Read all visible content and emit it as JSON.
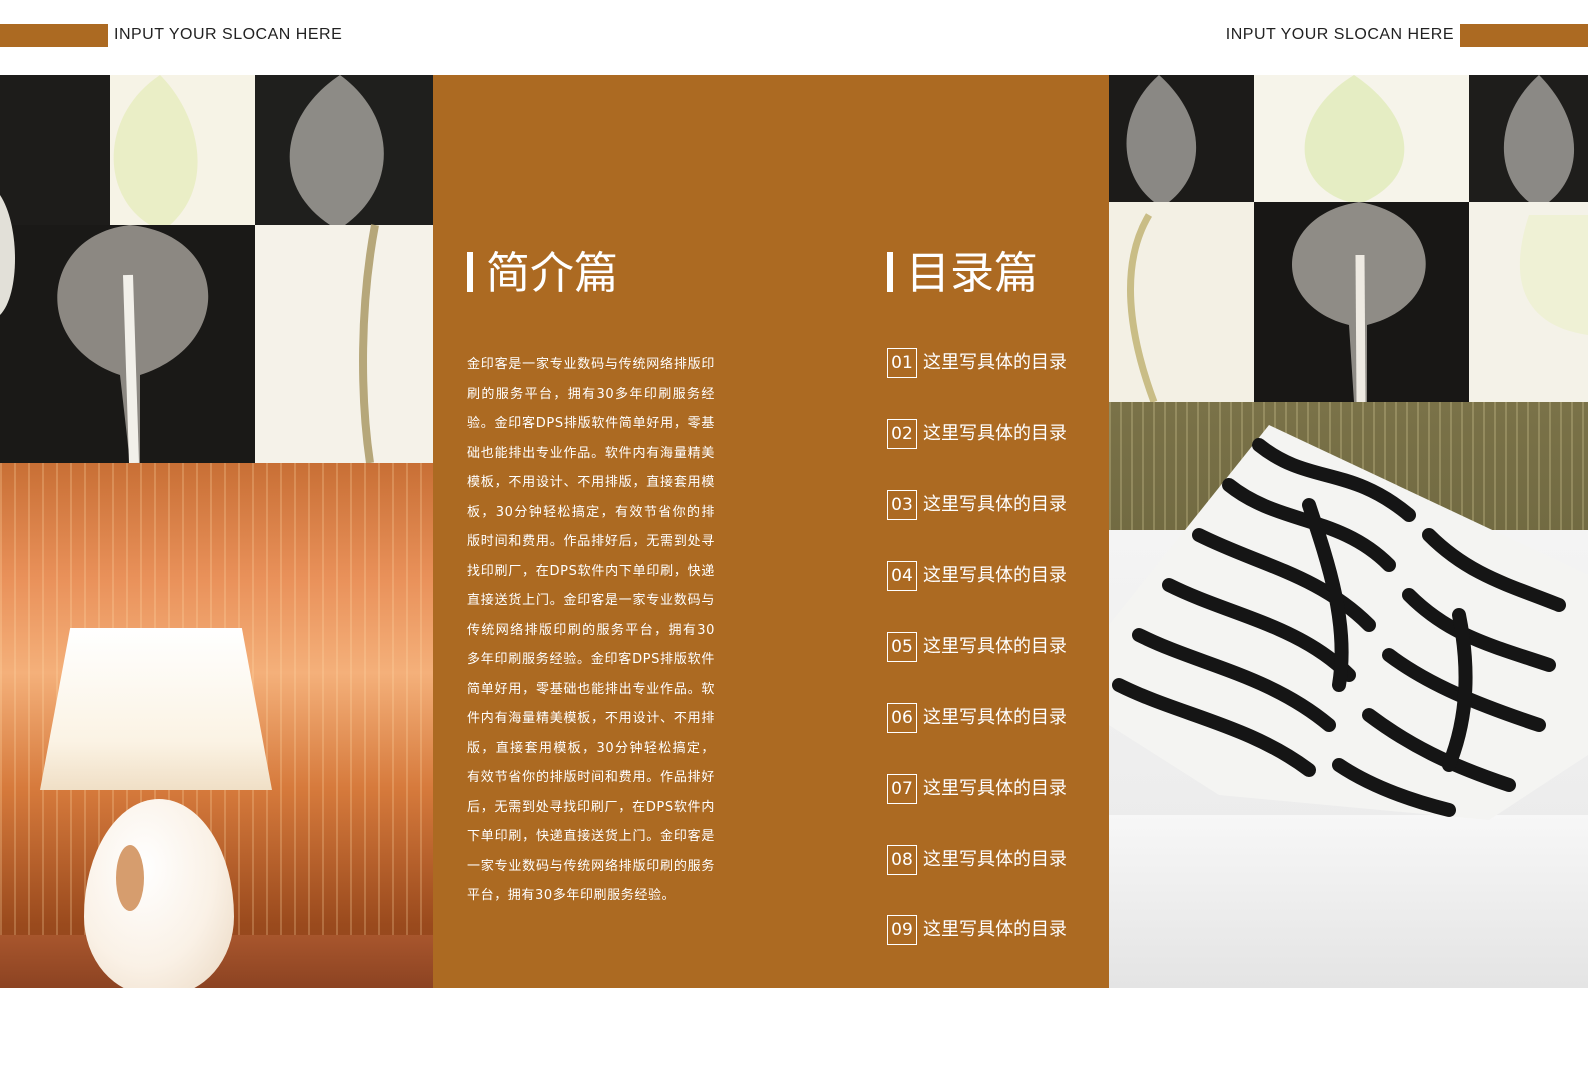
{
  "header": {
    "slogan_left": "INPUT YOUR SLOCAN HERE",
    "slogan_right": "INPUT YOUR SLOCAN HERE"
  },
  "colors": {
    "brand_brown": "#ac6a22",
    "text_white": "#ffffff"
  },
  "intro": {
    "title": "简介篇",
    "body": "金印客是一家专业数码与传统网络排版印刷的服务平台，拥有30多年印刷服务经验。金印客DPS排版软件简单好用，零基础也能排出专业作品。软件内有海量精美模板，不用设计、不用排版，直接套用模板，30分钟轻松搞定，有效节省你的排版时间和费用。作品排好后，无需到处寻找印刷厂，在DPS软件内下单印刷，快递直接送货上门。金印客是一家专业数码与传统网络排版印刷的服务平台，拥有30多年印刷服务经验。金印客DPS排版软件简单好用，零基础也能排出专业作品。软件内有海量精美模板，不用设计、不用排版，直接套用模板，30分钟轻松搞定，有效节省你的排版时间和费用。作品排好后，无需到处寻找印刷厂，在DPS软件内下单印刷，快递直接送货上门。金印客是一家专业数码与传统网络排版印刷的服务平台，拥有30多年印刷服务经验。"
  },
  "toc": {
    "title": "目录篇",
    "items": [
      {
        "num": "01",
        "label": "这里写具体的目录"
      },
      {
        "num": "02",
        "label": "这里写具体的目录"
      },
      {
        "num": "03",
        "label": "这里写具体的目录"
      },
      {
        "num": "04",
        "label": "这里写具体的目录"
      },
      {
        "num": "05",
        "label": "这里写具体的目录"
      },
      {
        "num": "06",
        "label": "这里写具体的目录"
      },
      {
        "num": "07",
        "label": "这里写具体的目录"
      },
      {
        "num": "08",
        "label": "这里写具体的目录"
      },
      {
        "num": "09",
        "label": "这里写具体的目录"
      }
    ]
  }
}
